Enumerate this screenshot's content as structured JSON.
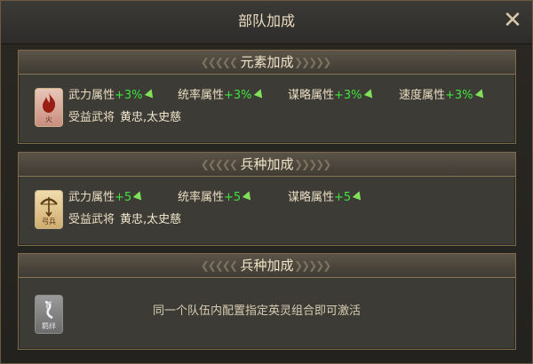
{
  "window": {
    "title": "部队加成",
    "close_icon": "close-icon"
  },
  "panels": [
    {
      "title": "元素加成",
      "badge": {
        "icon": "fire-icon",
        "label": "火"
      },
      "attributes": [
        {
          "label": "武力属性",
          "value": "+3%"
        },
        {
          "label": "统率属性",
          "value": "+3%"
        },
        {
          "label": "谋略属性",
          "value": "+3%"
        },
        {
          "label": "速度属性",
          "value": "+3%"
        }
      ],
      "beneficiary": {
        "label": "受益武将",
        "names": "黄忠,太史慈"
      }
    },
    {
      "title": "兵种加成",
      "badge": {
        "icon": "bow-icon",
        "label": "弓兵"
      },
      "attributes": [
        {
          "label": "武力属性",
          "value": "+5"
        },
        {
          "label": "统率属性",
          "value": "+5"
        },
        {
          "label": "谋略属性",
          "value": "+5"
        }
      ],
      "beneficiary": {
        "label": "受益武将",
        "names": "黄忠,太史慈"
      }
    },
    {
      "title": "兵种加成",
      "badge": {
        "icon": "fetter-icon",
        "label": "羁绊"
      },
      "message": "同一个队伍内配置指定英灵组合即可激活"
    }
  ],
  "colors": {
    "accent_value": "#3fe43f",
    "text": "#e9dcc2",
    "border": "#7c6a4b"
  }
}
